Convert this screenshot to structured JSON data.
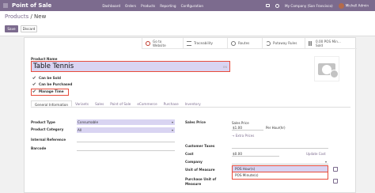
{
  "navbar": {
    "brand": "Point of Sale",
    "menu": [
      "Dashboard",
      "Orders",
      "Products",
      "Reporting",
      "Configuration"
    ],
    "company": "My Company (San Francisco)",
    "user": "Michell Admin",
    "accent": "#7c6b8e"
  },
  "breadcrumb": {
    "parent": "Products",
    "separator": " / ",
    "current": "New"
  },
  "buttons": {
    "save": "Save",
    "discard": "Discard"
  },
  "stats": {
    "website": "Go to\nWebsite",
    "traceability": "Traceability",
    "routes": "Routes",
    "putaway": "Putaway Rules",
    "sold_value": "0.00 POS Min...",
    "sold_label": "Sold"
  },
  "product": {
    "name_label": "Product Name",
    "name": "Table Tennis",
    "lang_flag": "EN",
    "can_be_sold": "Can be Sold",
    "can_be_purchased": "Can be Purchased",
    "manage_time": "Manage Time"
  },
  "tabs": [
    "General Information",
    "Variants",
    "Sales",
    "Point of Sale",
    "eCommerce",
    "Purchase",
    "Inventory"
  ],
  "general": {
    "product_type_label": "Product Type",
    "product_type": "Consumable",
    "product_category_label": "Product Category",
    "product_category": "All",
    "internal_ref_label": "Internal Reference",
    "barcode_label": "Barcode",
    "sales_price_label": "Sales Price",
    "sales_price_sub": "Sales Price",
    "sales_price": "$1.00",
    "per_hour": "Per Hour(hr)",
    "extra_prices": "Extra Prices",
    "customer_taxes_label": "Customer Taxes",
    "cost_label": "Cost",
    "cost": "$0.00",
    "update_cost": "Update Cost",
    "company_label": "Company",
    "uom_label": "Unit of Measure",
    "uom": "POS Minute(s)",
    "purchase_uom_label": "Purchase Unit of Measure"
  },
  "uom_dropdown": {
    "options": [
      "POS Hour(s)",
      "POS Minute(s)"
    ]
  }
}
